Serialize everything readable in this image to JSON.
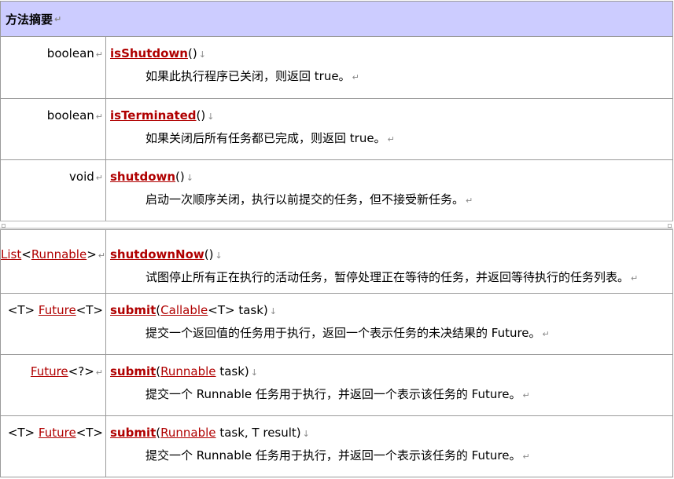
{
  "header": {
    "title": "方法摘要",
    "mark": "↵"
  },
  "rows": [
    {
      "ret": [
        "boolean"
      ],
      "ret_mark": "↵",
      "method": "isShutdown",
      "params": "()",
      "sig_mark": "↓",
      "desc": "如果此执行程序已关闭，则返回 true。",
      "desc_mark": "↵"
    },
    {
      "ret": [
        "boolean"
      ],
      "ret_mark": "↵",
      "method": "isTerminated",
      "params": "()",
      "sig_mark": "↓",
      "desc": "如果关闭后所有任务都已完成，则返回 true。",
      "desc_mark": "↵"
    },
    {
      "ret": [
        "void"
      ],
      "ret_mark": "↵",
      "method": "shutdown",
      "params": "()",
      "sig_mark": "↓",
      "desc": "启动一次顺序关闭，执行以前提交的任务，但不接受新任务。",
      "desc_mark": "↵"
    },
    {
      "ret": [
        "List",
        "<",
        "Runnable",
        ">"
      ],
      "ret_mark": "↵",
      "method": "shutdownNow",
      "params": "()",
      "sig_mark": "↓",
      "desc": "试图停止所有正在执行的活动任务，暂停处理正在等待的任务，并返回等待执行的任务列表。",
      "desc_mark": "↵"
    },
    {
      "ret": [
        "<T> ",
        "Future",
        "<T>"
      ],
      "ret_mark": "↵",
      "method": "submit",
      "p_open": "(",
      "p_type": "Callable",
      "p_rest": "<T> task)",
      "sig_mark": "↓",
      "desc": "提交一个返回值的任务用于执行，返回一个表示任务的未决结果的 Future。",
      "desc_mark": "↵"
    },
    {
      "ret": [
        "Future",
        "<?>"
      ],
      "ret_mark": "↵",
      "method": "submit",
      "p_open": "(",
      "p_type": "Runnable",
      "p_rest": " task)",
      "sig_mark": "↓",
      "desc": "提交一个 Runnable 任务用于执行，并返回一个表示该任务的 Future。",
      "desc_mark": "↵"
    },
    {
      "ret": [
        "<T> ",
        "Future",
        "<T>"
      ],
      "ret_mark": "↵",
      "method": "submit",
      "p_open": "(",
      "p_type": "Runnable",
      "p_rest": " task, T result)",
      "sig_mark": "↓",
      "desc": "提交一个 Runnable 任务用于执行，并返回一个表示该任务的 Future。",
      "desc_mark": "↵"
    }
  ]
}
